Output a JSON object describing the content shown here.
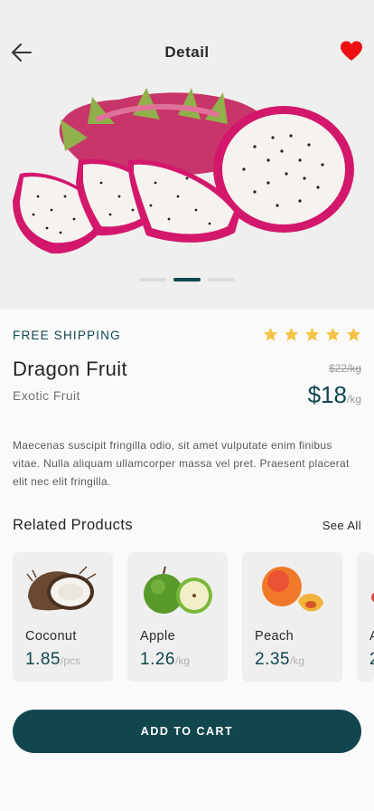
{
  "header": {
    "title": "Detail"
  },
  "product": {
    "shipping": "FREE SHIPPING",
    "rating": 5,
    "name": "Dragon Fruit",
    "category": "Exotic Fruit",
    "old_price": "$22/kg",
    "price": "$18",
    "price_unit": "/kg",
    "description": "Maecenas suscipit fringilla odio, sit amet vulputate enim finibus vitae. Nulla aliquam ullamcorper massa vel pret. Praesent placerat elit nec elit fringilla."
  },
  "carousel": {
    "count": 3,
    "active": 2
  },
  "related": {
    "title": "Related Products",
    "see_all": "See All",
    "items": [
      {
        "name": "Coconut",
        "price": "1.85",
        "unit": "/pcs",
        "icon": "coconut-image"
      },
      {
        "name": "Apple",
        "price": "1.26",
        "unit": "/kg",
        "icon": "apple-image"
      },
      {
        "name": "Peach",
        "price": "2.35",
        "unit": "/kg",
        "icon": "peach-image"
      },
      {
        "name": "A",
        "price": "2",
        "unit": "",
        "icon": "fruit-image"
      }
    ]
  },
  "actions": {
    "add_to_cart": "ADD TO CART"
  },
  "colors": {
    "accent": "#12464f",
    "heart": "#ee1111",
    "star": "#f5c242"
  }
}
